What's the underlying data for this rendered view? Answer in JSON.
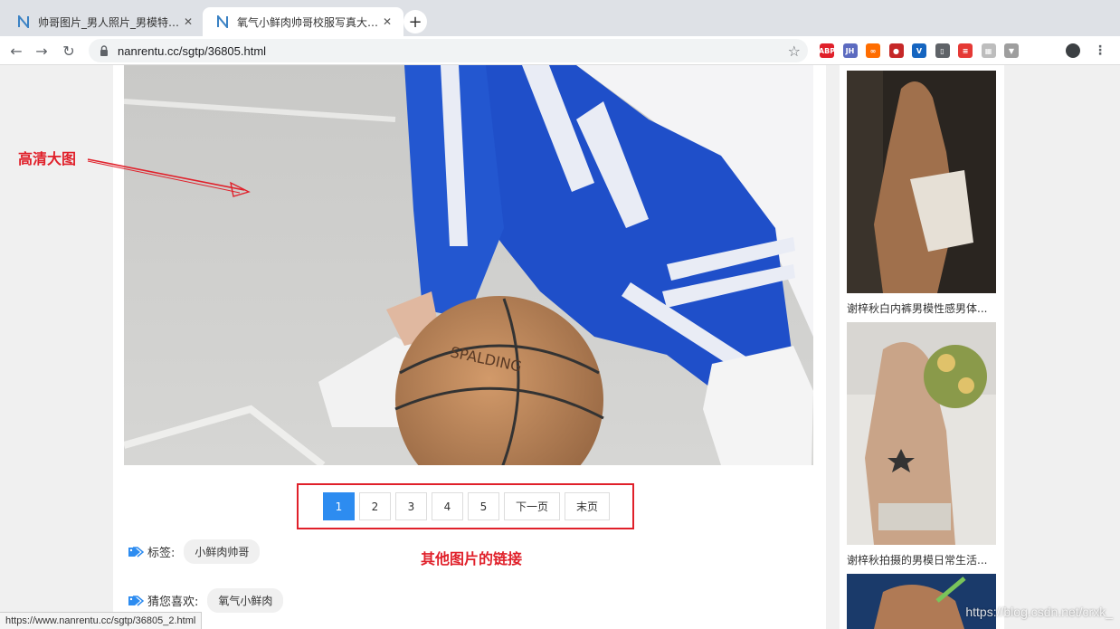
{
  "tabs": [
    {
      "title": "帅哥图片_男人照片_男模特图片...",
      "favicon": "n-logo-icon"
    },
    {
      "title": "氧气小鲜肉帅哥校服写真大全-男...",
      "favicon": "n-logo-icon"
    }
  ],
  "toolbar": {
    "url": "nanrentu.cc/sgtp/36805.html",
    "extensions": [
      {
        "name": "abp-icon",
        "label": "ABP",
        "color": "#e0202a"
      },
      {
        "name": "jh-icon",
        "label": "JH",
        "color": "#5c6bc0"
      },
      {
        "name": "infinity-icon",
        "label": "∞",
        "color": "#ff6d00"
      },
      {
        "name": "record-icon",
        "label": "●",
        "color": "#c62828"
      },
      {
        "name": "vue-icon",
        "label": "V",
        "color": "#1565c0"
      },
      {
        "name": "bookmark-icon",
        "label": "▯",
        "color": "#5f6368"
      },
      {
        "name": "notes-icon",
        "label": "≡",
        "color": "#e53935"
      },
      {
        "name": "grid-icon",
        "label": "▦",
        "color": "#bdbdbd"
      },
      {
        "name": "vuetools-icon",
        "label": "▼",
        "color": "#9e9e9e"
      }
    ]
  },
  "annotations": {
    "hd_image": "高清大图",
    "other_links": "其他图片的链接"
  },
  "pagination": {
    "pages": [
      "1",
      "2",
      "3",
      "4",
      "5"
    ],
    "active": "1",
    "next": "下一页",
    "last": "末页"
  },
  "tags": {
    "label": "标签:",
    "chip": "小鲜肉帅哥"
  },
  "guess": {
    "label": "猜您喜欢:",
    "chip": "氧气小鲜肉"
  },
  "sidebar": {
    "items": [
      {
        "caption": "谢梓秋白内裤男模性感男体..."
      },
      {
        "caption": "谢梓秋拍摄的男模日常生活..."
      }
    ]
  },
  "statusbar": {
    "url": "https://www.nanrentu.cc/sgtp/36805_2.html"
  },
  "watermark": "https://blog.csdn.net/crxk_",
  "colors": {
    "accent": "#2d8cf0",
    "annotation_red": "#e0202a"
  }
}
